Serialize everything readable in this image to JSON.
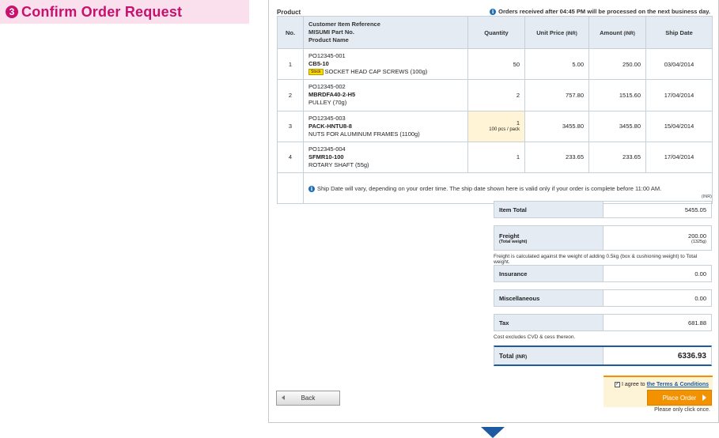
{
  "step": {
    "number": "3",
    "title": "Confirm Order Request"
  },
  "product_section": {
    "label": "Product",
    "notice": "Orders received after 04:45 PM will be processed on the next business day."
  },
  "table": {
    "headers": {
      "no": "No.",
      "ref_line1": "Customer Item Reference",
      "ref_line2": "MISUMI Part No.",
      "ref_line3": "Product Name",
      "quantity": "Quantity",
      "unit_price": "Unit Price",
      "unit_price_unit": "(INR)",
      "amount": "Amount",
      "amount_unit": "(INR)",
      "ship_date": "Ship Date"
    },
    "rows": [
      {
        "no": "1",
        "ref": "PO12345-001",
        "part": "CB5-10",
        "badge": "Stock",
        "name": "SOCKET HEAD CAP SCREWS (100g)",
        "qty": "50",
        "pack": "",
        "unit_price": "5.00",
        "amount": "250.00",
        "ship": "03/04/2014"
      },
      {
        "no": "2",
        "ref": "PO12345-002",
        "part": "MBRDFA40-2-H5",
        "badge": "",
        "name": "PULLEY (70g)",
        "qty": "2",
        "pack": "",
        "unit_price": "757.80",
        "amount": "1515.60",
        "ship": "17/04/2014"
      },
      {
        "no": "3",
        "ref": "PO12345-003",
        "part": "PACK-HNTU8-8",
        "badge": "",
        "name": "NUTS FOR ALUMINUM FRAMES (1100g)",
        "qty": "1",
        "pack": "100 pcs / pack",
        "unit_price": "3455.80",
        "amount": "3455.80",
        "ship": "15/04/2014"
      },
      {
        "no": "4",
        "ref": "PO12345-004",
        "part": "SFMR10-100",
        "badge": "",
        "name": "ROTARY SHAFT (55g)",
        "qty": "1",
        "pack": "",
        "unit_price": "233.65",
        "amount": "233.65",
        "ship": "17/04/2014"
      }
    ],
    "ship_note": "Ship Date will vary, depending on your order time. The ship date shown here is valid only if your order is complete before 11:00 AM."
  },
  "summary": {
    "currency_note": "(INR)",
    "item_total_label": "Item Total",
    "item_total": "5455.05",
    "freight_label": "Freight",
    "freight_sub_label": "(Total weight)",
    "freight": "200.00",
    "freight_weight": "(1325g)",
    "freight_note": "Freight is calculated against the weight of adding 0.5kg (box & cushioning weight) to Total weight.",
    "insurance_label": "Insurance",
    "insurance": "0.00",
    "misc_label": "Miscellaneous",
    "misc": "0.00",
    "tax_label": "Tax",
    "tax": "681.88",
    "tax_note": "Cost excludes CVD & cess thereon.",
    "total_label": "Total",
    "total_unit": "(INR)",
    "total": "6336.93"
  },
  "actions": {
    "agree_text": "I agree to",
    "terms_link": "the Terms & Conditions",
    "agree_checked": true,
    "place_order": "Place Order",
    "click_once": "Please only click once.",
    "back": "Back"
  },
  "colors": {
    "step_accent": "#c8106e",
    "step_bg": "#f9e0ec",
    "header_bg": "#e4ebf2",
    "order_button": "#f39200",
    "link_blue": "#1e5aa0"
  }
}
